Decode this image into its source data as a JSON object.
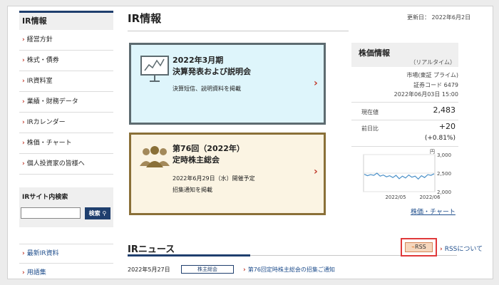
{
  "sidebar": {
    "heading": "IR情報",
    "items": [
      {
        "label": "経営方針"
      },
      {
        "label": "株式・債券"
      },
      {
        "label": "IR資料室"
      },
      {
        "label": "業績・財務データ"
      },
      {
        "label": "IRカレンダー"
      },
      {
        "label": "株価・チャート"
      },
      {
        "label": "個人投資家の皆様へ"
      }
    ],
    "search": {
      "title": "IRサイト内検索",
      "input_value": "",
      "button_label": "検索"
    },
    "links": [
      {
        "label": "最新IR資料"
      },
      {
        "label": "用語集"
      }
    ]
  },
  "header": {
    "title": "IR情報",
    "updated": "更新日： 2022年6月2日"
  },
  "cards": [
    {
      "title1": "2022年3月期",
      "title2": "決算発表および説明会",
      "desc1": "決算短信、説明資料を掲載",
      "desc2": "",
      "icon": "presentation-chart-icon",
      "bg": "#def5fb"
    },
    {
      "title1": "第76回（2022年）",
      "title2": "定時株主総会",
      "desc1": "2022年6月29日（水）開催予定",
      "desc2": "招集通知を掲載",
      "icon": "shareholders-icon",
      "bg": "#fbf4e3"
    }
  ],
  "stock": {
    "heading": "株価情報",
    "subheading": "（リアルタイム）",
    "market": "市場(東証 プライム)",
    "code": "証券コード 6479",
    "datetime": "2022年06月03日 15:00",
    "current_label": "現在値",
    "current_value": "2,483",
    "change_label": "前日比",
    "change_value": "+20",
    "change_pct": "(+0.81%)",
    "chart": {
      "unit": "円",
      "y_ticks": [
        "3,000",
        "2,500",
        "2,000"
      ],
      "x_ticks": [
        "2022/05",
        "2022/06"
      ]
    },
    "chart_link": "株価・チャート"
  },
  "chart_data": {
    "type": "line",
    "ylim": [
      2000,
      3000
    ],
    "y_tick_values": [
      3000,
      2500,
      2000
    ],
    "x_tick_labels": [
      "2022/05",
      "2022/06"
    ],
    "series": [
      {
        "values": [
          2470,
          2430,
          2460,
          2440,
          2500,
          2420,
          2450,
          2400,
          2430,
          2380,
          2440,
          2350,
          2420,
          2370,
          2450,
          2390,
          2420,
          2340,
          2430,
          2380,
          2460,
          2440,
          2483
        ]
      }
    ],
    "color": "#4a90c8"
  },
  "news": {
    "title": "IRニュース",
    "rss_label": "RSS",
    "rss_about": "RSSについて",
    "items": [
      {
        "date": "2022年5月27日",
        "tag": "株主総会",
        "title": "第76回定時株主総会の招集ご通知"
      }
    ]
  },
  "colors": {
    "navy": "#1f3f6e",
    "arrow_red": "#c0392b",
    "rss_border": "#e0393a"
  }
}
